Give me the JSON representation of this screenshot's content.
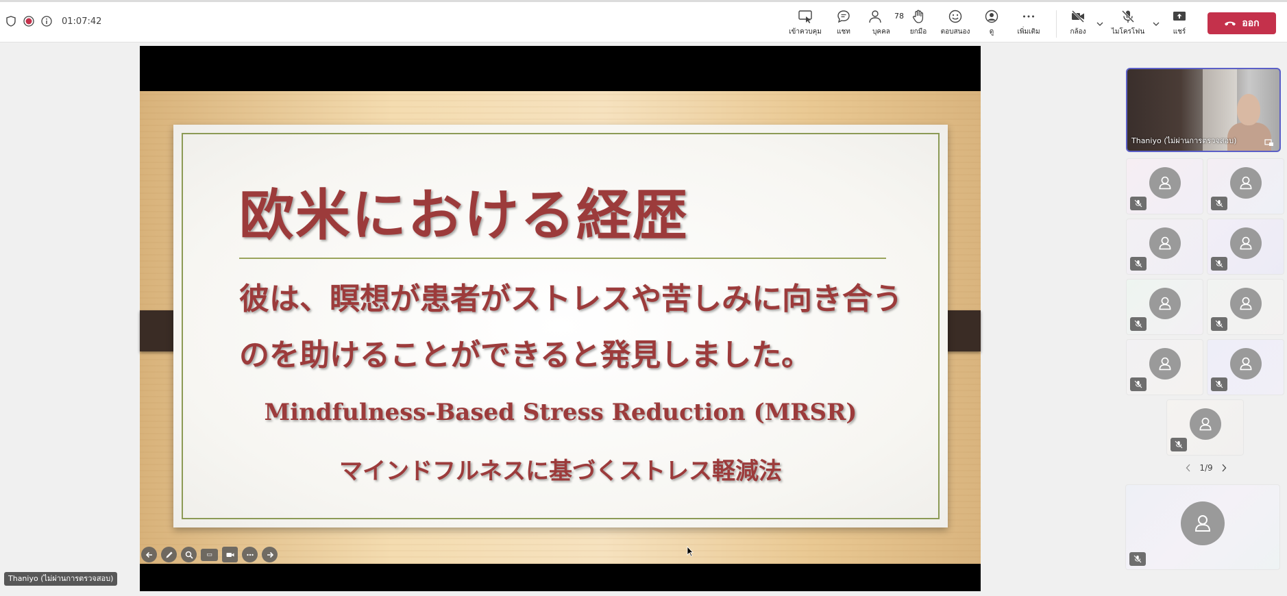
{
  "topbar": {
    "timer": "01:07:42",
    "tools": [
      {
        "id": "control",
        "label": "เข้าควบคุม",
        "icon": "present-control-icon"
      },
      {
        "id": "chat",
        "label": "แชท",
        "icon": "chat-icon"
      },
      {
        "id": "people",
        "label": "บุคคล",
        "icon": "people-icon",
        "count": "78"
      },
      {
        "id": "raise",
        "label": "ยกมือ",
        "icon": "raise-hand-icon"
      },
      {
        "id": "react",
        "label": "ตอบสนอง",
        "icon": "emoji-icon"
      },
      {
        "id": "view",
        "label": "ดู",
        "icon": "view-icon"
      },
      {
        "id": "more",
        "label": "เพิ่มเติม",
        "icon": "more-icon"
      },
      {
        "id": "camera",
        "label": "กล้อง",
        "icon": "camera-off-icon"
      },
      {
        "id": "mic",
        "label": "ไมโครโฟน",
        "icon": "mic-off-icon"
      },
      {
        "id": "share",
        "label": "แชร์",
        "icon": "share-icon"
      }
    ],
    "leave_label": "ออก"
  },
  "slide": {
    "title": "欧米における経歴",
    "line1": "彼は、瞑想が患者がストレスや苦しみに向き合う",
    "line2": "のを助けることができると発見しました。",
    "line3": "Mindfulness-Based Stress Reduction (MRSR)",
    "line4": "マインドフルネスに基づくストレス軽減法"
  },
  "presenter": {
    "name_tag": "Thaniyo (ไม่ผ่านการตรวจสอบ)"
  },
  "panel": {
    "main_tile_name": "Thaniyo (ไม่ผ่านการตรวจสอบ)",
    "pager": "1/9"
  },
  "colors": {
    "accent": "#5b5fc7",
    "leave": "#c4314b",
    "slide_text": "#9c3b3b",
    "slide_frame": "#8c9a55"
  }
}
